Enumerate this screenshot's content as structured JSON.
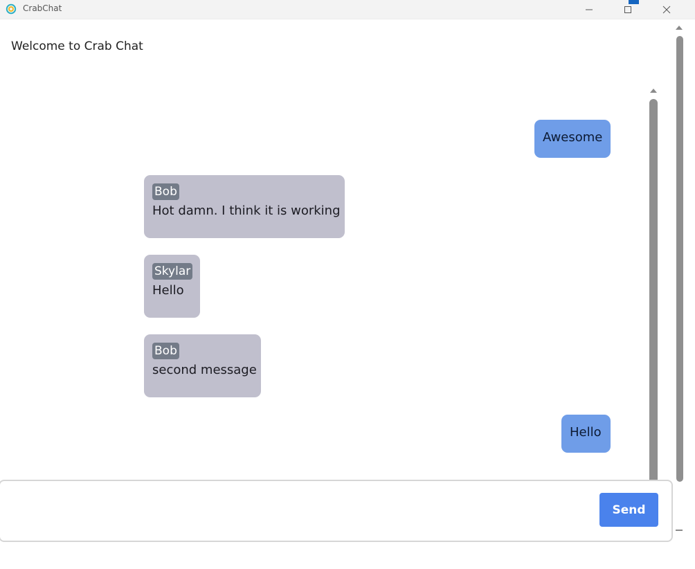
{
  "window": {
    "title": "CrabChat",
    "icon": "crab-chat-icon",
    "accent": "#1565c0"
  },
  "page": {
    "welcome": "Welcome to Crab Chat"
  },
  "messages": [
    {
      "own": true,
      "sender": "",
      "text": "Awesome"
    },
    {
      "own": false,
      "sender": "Bob",
      "text": "Hot damn. I think it is working"
    },
    {
      "own": false,
      "sender": "Skylar",
      "text": "Hello"
    },
    {
      "own": false,
      "sender": "Bob",
      "text": "second message"
    },
    {
      "own": true,
      "sender": "",
      "text": "Hello"
    }
  ],
  "composer": {
    "input_value": "",
    "input_placeholder": "",
    "send_label": "Send"
  },
  "colors": {
    "own_bubble": "#6f9de8",
    "other_bubble": "#c0bfcd",
    "sender_tag": "#737b88",
    "send_button": "#4a82ec"
  }
}
